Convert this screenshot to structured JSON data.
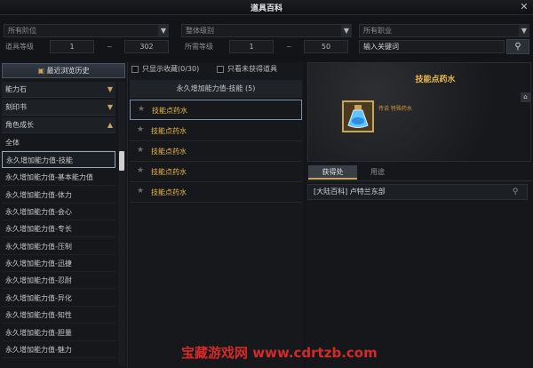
{
  "window": {
    "title": "道具百科",
    "close_label": "✕"
  },
  "filters": {
    "grade": {
      "value": "所有阶位"
    },
    "level_overall": {
      "value": "整体级别"
    },
    "job": {
      "value": "所有职业"
    },
    "item_level": {
      "label": "道具等级",
      "min": "1",
      "max": "302"
    },
    "required_level": {
      "label": "所需等级",
      "min": "1",
      "max": "50"
    },
    "tilde": "~",
    "search_value": "输入关键词"
  },
  "left": {
    "history_label": "最近浏览历史",
    "categories": [
      {
        "label": "能力石"
      },
      {
        "label": "刻印书"
      },
      {
        "label": "角色成长"
      }
    ],
    "sub_items": [
      {
        "label": "全体"
      },
      {
        "label": "永久增加能力值-技能"
      },
      {
        "label": "永久增加能力值-基本能力值"
      },
      {
        "label": "永久增加能力值-体力"
      },
      {
        "label": "永久增加能力值-会心"
      },
      {
        "label": "永久增加能力值-专长"
      },
      {
        "label": "永久增加能力值-压制"
      },
      {
        "label": "永久增加能力值-迅捷"
      },
      {
        "label": "永久增加能力值-忍耐"
      },
      {
        "label": "永久增加能力值-异化"
      },
      {
        "label": "永久增加能力值-知性"
      },
      {
        "label": "永久增加能力值-胆量"
      },
      {
        "label": "永久增加能力值-魅力"
      }
    ]
  },
  "middle": {
    "show_favorites_label": "只显示收藏(0/30)",
    "show_unacquired_label": "只看未获得道具",
    "list_header": "永久增加能力值-技能 (5)",
    "items": [
      {
        "name": "技能点药水"
      },
      {
        "name": "技能点药水"
      },
      {
        "name": "技能点药水"
      },
      {
        "name": "技能点药水"
      },
      {
        "name": "技能点药水"
      }
    ]
  },
  "detail": {
    "name": "技能点药水",
    "subtitle": "传说 特殊药水",
    "tabs": [
      "获得处",
      "用途"
    ],
    "source": "[大陆百科] 卢特兰东部"
  },
  "watermark": "宝藏游戏网 www.cdrtzb.com",
  "colors": {
    "accent_gold": "#e8b84a",
    "watermark_red": "#d32a2a"
  }
}
